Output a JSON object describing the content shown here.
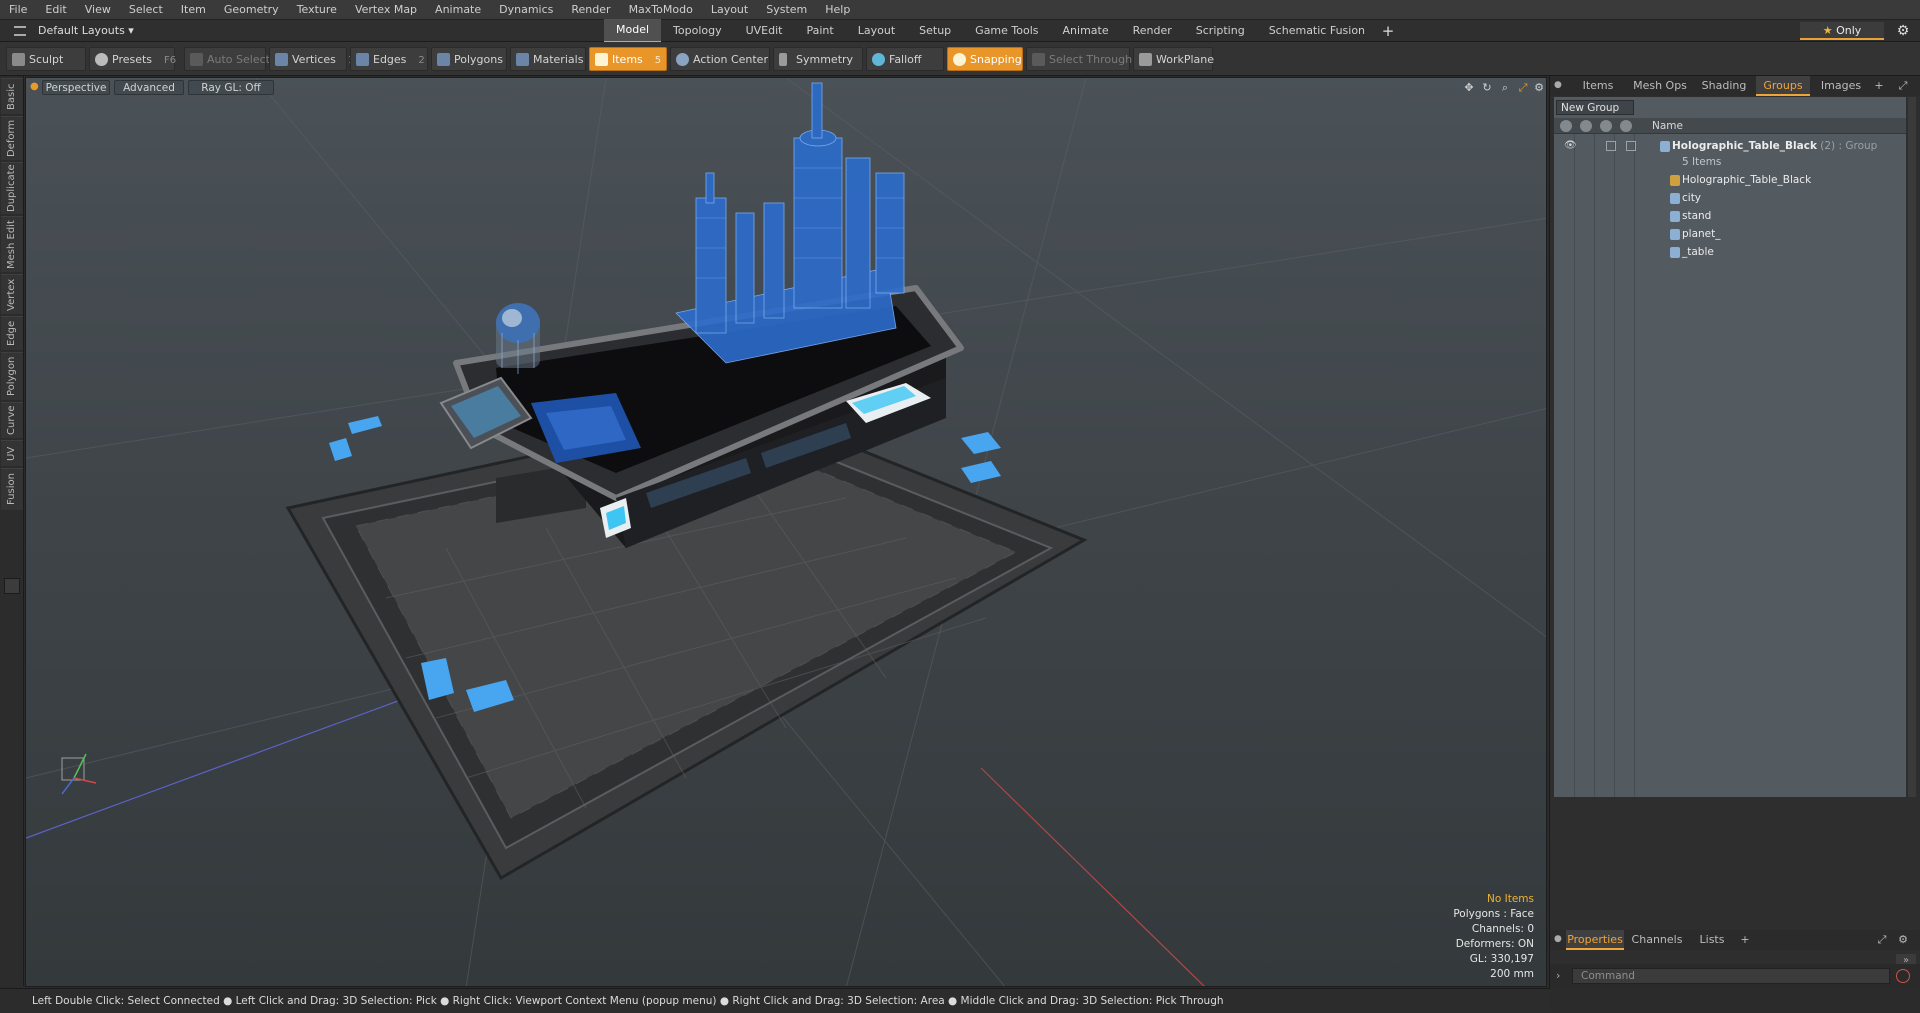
{
  "menu": [
    "File",
    "Edit",
    "View",
    "Select",
    "Item",
    "Geometry",
    "Texture",
    "Vertex Map",
    "Animate",
    "Dynamics",
    "Render",
    "MaxToModo",
    "Layout",
    "System",
    "Help"
  ],
  "layout_selector": "Default Layouts ▾",
  "mode_tabs": [
    "Model",
    "Topology",
    "UVEdit",
    "Paint",
    "Layout",
    "Setup",
    "Game Tools",
    "Animate",
    "Render",
    "Scripting",
    "Schematic Fusion"
  ],
  "active_mode_tab": "Model",
  "only_button": "Only",
  "toolbar": {
    "sculpt": "Sculpt",
    "presets": "Presets",
    "presets_key": "F6",
    "auto_select": "Auto Select",
    "vertices": "Vertices",
    "vertices_key": "1",
    "edges": "Edges",
    "edges_key": "2",
    "polygons": "Polygons",
    "materials": "Materials",
    "items": "Items",
    "items_key": "5",
    "action_center": "Action Center",
    "symmetry": "Symmetry",
    "falloff": "Falloff",
    "snapping": "Snapping",
    "select_through": "Select Through",
    "workplane": "WorkPlane"
  },
  "left_tabs": [
    "Basic",
    "Deform",
    "Duplicate",
    "Mesh Edit",
    "Vertex",
    "Edge",
    "Polygon",
    "Curve",
    "UV",
    "Fusion"
  ],
  "viewport": {
    "view_mode": "Perspective",
    "advanced": "Advanced",
    "raygl": "Ray GL: Off",
    "info": {
      "selection": "No Items",
      "polygons": "Polygons : Face",
      "channels": "Channels: 0",
      "deformers": "Deformers: ON",
      "gl": "GL: 330,197",
      "grid": "200 mm"
    }
  },
  "status_bar": "Left Double Click: Select Connected ● Left Click and Drag: 3D Selection: Pick ● Right Click: Viewport Context Menu (popup menu) ● Right Click and Drag: 3D Selection: Area ● Middle Click and Drag: 3D Selection: Pick Through",
  "right_panel": {
    "tabs": [
      "Items",
      "Mesh Ops",
      "Shading",
      "Groups",
      "Images"
    ],
    "active_tab": "Groups",
    "new_group": "New Group",
    "name_column": "Name",
    "group": {
      "name": "Holographic_Table_Black",
      "count_suffix": "(2) : Group",
      "items_count": "5 Items",
      "children": [
        "Holographic_Table_Black",
        "city",
        "stand",
        "planet_",
        "_table"
      ]
    },
    "bottom_tabs": [
      "Properties",
      "Channels",
      "Lists"
    ],
    "active_bottom_tab": "Properties",
    "command_placeholder": "Command"
  },
  "colors": {
    "accent": "#e8952a",
    "hologram": "#3d7fd8",
    "table": "#1c1c1e",
    "floor": "#353536",
    "glow": "#3cc0ff"
  }
}
